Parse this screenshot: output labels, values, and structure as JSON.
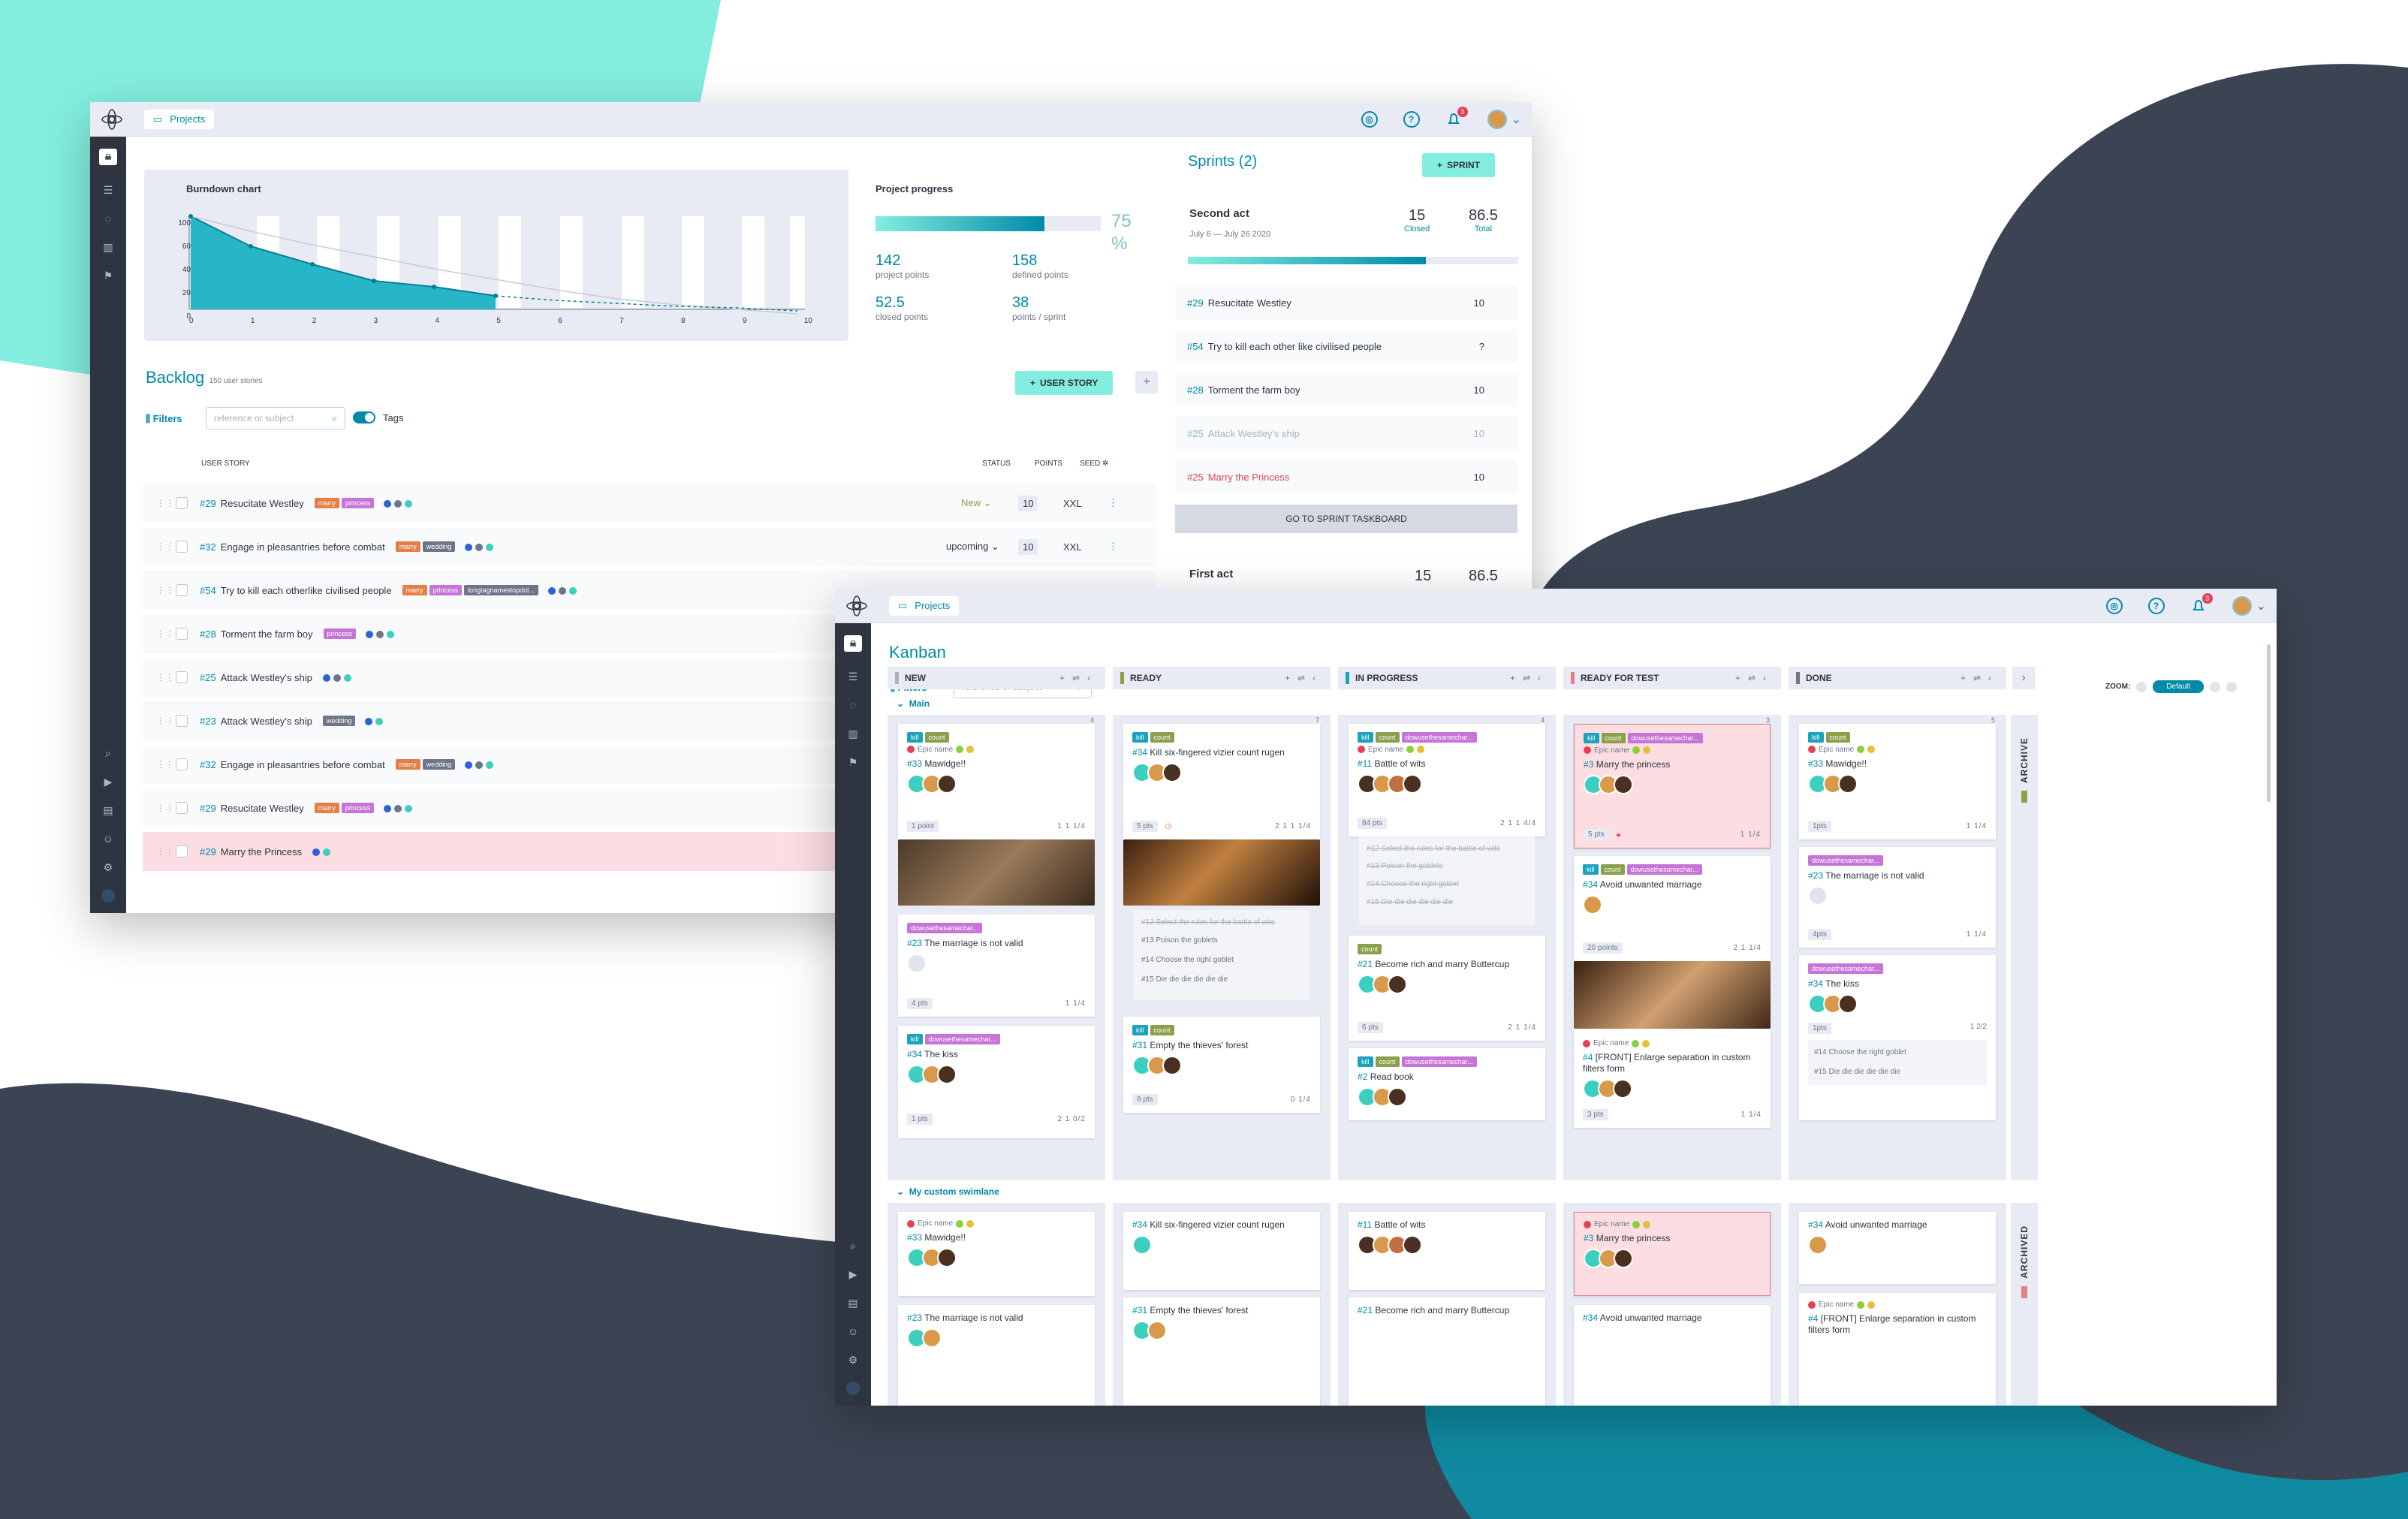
{
  "backlog_window": {
    "breadcrumb": "Projects",
    "notifications": "3",
    "burndown": {
      "title": "Burndown chart",
      "y_ticks": [
        "100",
        "60",
        "40",
        "20",
        "0"
      ],
      "x_ticks": [
        "0",
        "1",
        "2",
        "3",
        "4",
        "5",
        "6",
        "7",
        "8",
        "9",
        "10"
      ]
    },
    "progress": {
      "title": "Project progress",
      "percent": "75",
      "percent_sign": "%",
      "fill": 0.75,
      "stats": [
        {
          "value": "142",
          "label": "project points"
        },
        {
          "value": "158",
          "label": "defined points"
        },
        {
          "value": "52.5",
          "label": "closed points"
        },
        {
          "value": "38",
          "label": "points / sprint"
        }
      ]
    },
    "backlog": {
      "title": "Backlog",
      "count": "150 user stories",
      "add_label": "USER STORY",
      "add_plus": "+",
      "filters": "Filters",
      "search_placeholder": "reference or subject",
      "tags_label": "Tags",
      "headers": {
        "story": "USER STORY",
        "status": "STATUS",
        "points": "POINTS",
        "seed": "SEED"
      },
      "rows": [
        {
          "ref": "#29",
          "subject": "Resucitate Westley",
          "tags": [
            "marry",
            "princess"
          ],
          "status": "New",
          "points": "10",
          "size": "XXL"
        },
        {
          "ref": "#32",
          "subject": "Engage in pleasantries before combat",
          "tags": [
            "marry",
            "wedding"
          ],
          "status": "upcoming",
          "points": "10",
          "size": "XXL"
        },
        {
          "ref": "#54",
          "subject": "Try to kill each otherlike civilised  people",
          "tags": [
            "marry",
            "princess",
            "longtagnamestopdol..."
          ],
          "status": "",
          "points": "",
          "size": ""
        },
        {
          "ref": "#28",
          "subject": "Torment the farm boy",
          "tags": [
            "princess"
          ],
          "status": "",
          "points": "",
          "size": ""
        },
        {
          "ref": "#25",
          "subject": "Attack Westley's ship",
          "tags": [],
          "status": "",
          "points": "",
          "size": ""
        },
        {
          "ref": "#23",
          "subject": "Attack Westley's ship",
          "tags": [
            "wedding"
          ],
          "status": "",
          "points": "",
          "size": ""
        },
        {
          "ref": "#32",
          "subject": "Engage in pleasantries before combat",
          "tags": [
            "marry",
            "wedding"
          ],
          "status": "",
          "points": "",
          "size": ""
        },
        {
          "ref": "#29",
          "subject": "Resucitate Westley",
          "tags": [
            "marry",
            "princess"
          ],
          "status": "",
          "points": "",
          "size": ""
        },
        {
          "ref": "#29",
          "subject": "Marry the Princess",
          "tags": [],
          "status": "",
          "points": "",
          "size": ""
        }
      ]
    },
    "sprints": {
      "title": "Sprints (2)",
      "add_label": "SPRINT",
      "current": {
        "name": "Second act",
        "dates": "July 6 — July 26 2020",
        "closed": "15",
        "closed_label": "Closed",
        "total": "86.5",
        "total_label": "Total",
        "fill": 0.72
      },
      "items": [
        {
          "ref": "#29",
          "subject": "Resucitate Westley",
          "points": "10"
        },
        {
          "ref": "#54",
          "subject": "Try to kill each other like civilised people",
          "points": "?"
        },
        {
          "ref": "#28",
          "subject": "Torment the farm boy",
          "points": "10"
        },
        {
          "ref": "#25",
          "subject": "Attack Westley's ship",
          "points": "10"
        },
        {
          "ref": "#25",
          "subject": "Marry the Princess",
          "points": "10"
        }
      ],
      "taskboard_btn": "GO TO SPRINT TASKBOARD",
      "next": {
        "name": "First act",
        "closed": "15",
        "total": "86.5"
      }
    }
  },
  "kanban_window": {
    "breadcrumb": "Projects",
    "notifications": "3",
    "title": "Kanban",
    "filters": "Filters",
    "search_placeholder": "reference or subject",
    "zoom_label": "ZOOM:",
    "zoom_value": "Default",
    "columns": [
      "NEW",
      "READY",
      "IN PROGRESS",
      "READY FOR TEST",
      "DONE"
    ],
    "swimlanes": [
      "Main",
      "My custom swimlane"
    ],
    "archive": "ARCHIVE",
    "archived": "ARCHIVED",
    "cards": {
      "c1": {
        "tags": [
          "kill",
          "count"
        ],
        "epic": "Epic name",
        "ref": "#33",
        "title": "Mawidge!!",
        "pts": "1 point",
        "meta": "1 1 1/4"
      },
      "c2": {
        "tags": [
          "dowusethesamechar..."
        ],
        "ref": "#23",
        "title": "The marriage is not valid",
        "pts": "4 pts",
        "meta": "1 1/4"
      },
      "c3": {
        "tags": [
          "kill",
          "dowusethesamechar..."
        ],
        "ref": "#34",
        "title": "The kiss",
        "pts": "1 pts",
        "meta": "2 1 0/2"
      },
      "c4": {
        "tags": [
          "kill",
          "count"
        ],
        "ref": "#34",
        "title": "Kill six-fingered vizier count rugen",
        "pts": "5 pts",
        "meta": "2 1 1 1/4",
        "tasks": [
          "#12 Select the rules for the battle of wits",
          "#13 Poison the goblets",
          "#14 Choose the right goblet",
          "#15 Die die die die die die"
        ]
      },
      "c5": {
        "tags": [
          "kill",
          "count"
        ],
        "ref": "#31",
        "title": "Empty the thieves' forest",
        "pts": "8 pts",
        "meta": "0 1/4"
      },
      "c6": {
        "tags": [
          "kill",
          "count",
          "dowusethesamechar..."
        ],
        "epic": "Epic name",
        "ref": "#11",
        "title": "Battle of wits",
        "pts": "84 pts",
        "meta": "2 1 1 4/4",
        "tasks": [
          "#12 Select the rules for the battle of wits",
          "#13 Poison the goblets",
          "#14 Choose the right goblet",
          "#15 Die die die die die die"
        ]
      },
      "c7": {
        "tags": [
          "count"
        ],
        "ref": "#21",
        "title": "Become rich and marry Buttercup",
        "pts": "6 pts",
        "meta": "2 1 1/4"
      },
      "c8": {
        "tags": [
          "kill",
          "count",
          "dowusethesamechar..."
        ],
        "ref": "#2",
        "title": "Read book"
      },
      "c9": {
        "tags": [
          "kill",
          "count",
          "dowusethesamechar..."
        ],
        "epic": "Epic name",
        "ref": "#3",
        "title": "Marry the princess",
        "pts": "5 pts",
        "meta": "1 1/4"
      },
      "c10": {
        "tags": [
          "kill",
          "count",
          "dowusethesamechar..."
        ],
        "ref": "#34",
        "title": "Avoid unwanted marriage",
        "pts": "20 points",
        "meta": "2 1 1/4"
      },
      "c11": {
        "epic": "Epic name",
        "ref": "#4",
        "title": "[FRONT] Enlarge separation in custom filters form",
        "pts": "3 pts",
        "meta": "1 1/4"
      },
      "c12": {
        "tags": [
          "kill",
          "count"
        ],
        "epic": "Epic name",
        "ref": "#33",
        "title": "Mawidge!!",
        "pts": "1pts",
        "meta": "1 1/4"
      },
      "c13": {
        "tags": [
          "dowusethesamechar..."
        ],
        "ref": "#23",
        "title": "The marriage is not valid",
        "pts": "4pts",
        "meta": "1 1/4"
      },
      "c14": {
        "tags": [
          "dowusethesamechar..."
        ],
        "ref": "#34",
        "title": "The kiss",
        "pts": "1pts",
        "meta": "1 2/2",
        "tasks": [
          "#14 Choose the right goblet",
          "#15 Die die die die die die"
        ]
      },
      "s1": {
        "epic": "Epic name",
        "ref": "#33",
        "title": "Mawidge!!"
      },
      "s2": {
        "ref": "#23",
        "title": "The marriage is not valid"
      },
      "s3": {
        "ref": "#34",
        "title": "Kill six-fingered vizier count rugen"
      },
      "s4": {
        "ref": "#31",
        "title": "Empty the thieves' forest"
      },
      "s5": {
        "ref": "#11",
        "title": "Battle of wits"
      },
      "s6": {
        "ref": "#21",
        "title": "Become rich and marry Buttercup"
      },
      "s7": {
        "epic": "Epic name",
        "ref": "#3",
        "title": "Marry the princess"
      },
      "s8": {
        "ref": "#34",
        "title": "Avoid unwanted marriage"
      },
      "s9": {
        "ref": "#34",
        "title": "Avoid unwanted marriage"
      },
      "s10": {
        "epic": "Epic name",
        "ref": "#4",
        "title": "[FRONT] Enlarge separation in custom filters form"
      }
    },
    "column_counts": [
      "4",
      "7",
      "4",
      "3",
      "5"
    ]
  },
  "colors": {
    "teal": "#008aa8",
    "mint": "#83eedf",
    "dark": "#2e3440",
    "red": "#e44057",
    "tag_marry": "#e57f47",
    "tag_princess": "#c774d8",
    "tag_wedding": "#6d7587",
    "tag_kill": "#1aa3be",
    "tag_count": "#8ba04a"
  }
}
